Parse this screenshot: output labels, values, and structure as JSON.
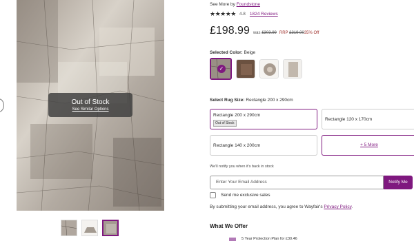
{
  "gallery": {
    "out_of_stock_title": "Out of Stock",
    "out_of_stock_link": "See Similar Options",
    "thumbnails": [
      "rug-pattern-1",
      "rug-room",
      "rug-pattern-3"
    ],
    "selected_thumbnail": 2
  },
  "product": {
    "see_more_prefix": "See More by",
    "brand": "Foundstone",
    "stars": "★★★★★",
    "rating": "4.8",
    "reviews": "1824 Reviews",
    "price": "£198.99",
    "was_label": "was",
    "was_price": "£303.99",
    "rrp_label": "RRP",
    "rrp_price": "£319.00",
    "off": "35% Off"
  },
  "color": {
    "label": "Selected Color:",
    "value": "Beige",
    "swatch_colors": [
      "#9a8f86",
      "#6b5140",
      "#a89b8f",
      "#c2b8ad"
    ]
  },
  "size": {
    "label": "Select Rug Size:",
    "value": "Rectangle 200 x 290cm",
    "options": [
      {
        "label": "Rectangle 200 x 290cm",
        "tag": "Out of Stock"
      },
      {
        "label": "Rectangle 120 x 170cm"
      },
      {
        "label": "Rectangle 140 x 200cm"
      },
      {
        "label": "+ 5 More"
      }
    ]
  },
  "notify": {
    "note": "We'll notify you when it's back in stock",
    "email_placeholder": "Enter Your Email Address",
    "button": "Notify Me",
    "sales_checkbox": "Send me exclusive sales",
    "agree_text": "By submitting your email address, you agree to Wayfair's",
    "privacy_link": "Privacy Policy",
    "agree_end": "."
  },
  "offer": {
    "title": "What We Offer",
    "item": "5 Year Protection Plan for £30.46"
  },
  "colors": {
    "accent": "#7f187f"
  }
}
